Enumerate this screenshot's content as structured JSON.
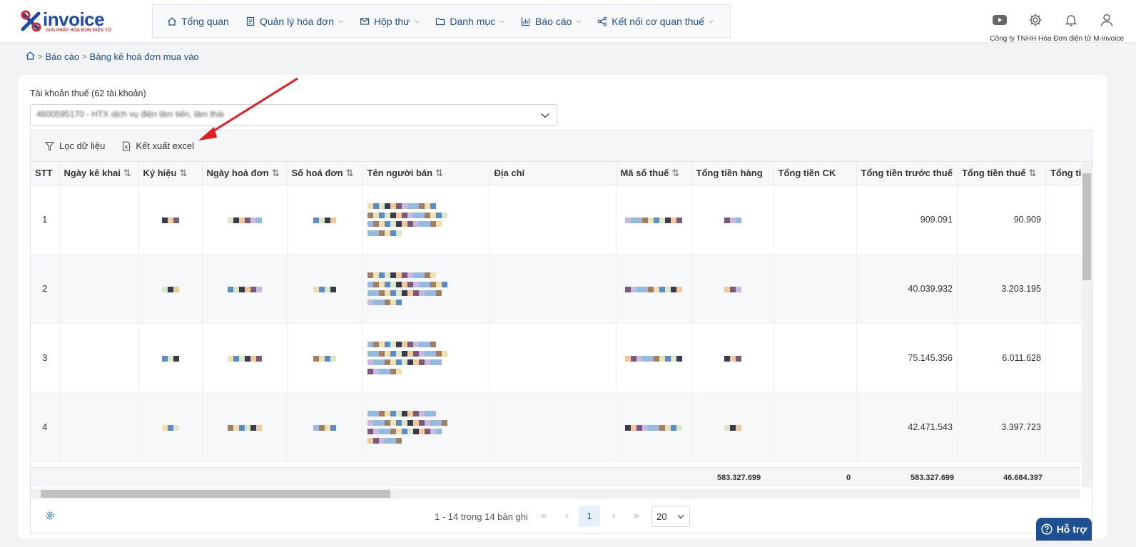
{
  "brand": {
    "name": "invoice",
    "tagline": "GIẢI PHÁP HÓA ĐƠN ĐIỆN TỬ"
  },
  "nav": [
    {
      "label": "Tổng quan",
      "icon": "home-icon",
      "dropdown": false
    },
    {
      "label": "Quản lý hóa đơn",
      "icon": "document-icon",
      "dropdown": true
    },
    {
      "label": "Hộp thư",
      "icon": "mail-icon",
      "dropdown": true
    },
    {
      "label": "Danh mục",
      "icon": "folder-icon",
      "dropdown": true
    },
    {
      "label": "Báo cáo",
      "icon": "bar-chart-icon",
      "dropdown": true
    },
    {
      "label": "Kết nối cơ quan thuế",
      "icon": "share-icon",
      "dropdown": true
    }
  ],
  "header": {
    "company": "Công ty TNHH Hóa Đơn điện tử M-invoice",
    "icons": [
      "youtube-icon",
      "gear-icon",
      "bell-icon",
      "user-icon"
    ]
  },
  "breadcrumb": {
    "home_icon": "home-icon",
    "items": [
      "Báo cáo",
      "Bảng kê hoá đơn mua vào"
    ]
  },
  "account": {
    "label": "Tài khoản thuế (62 tài khoản)",
    "value": "4600595170 - HTX dịch vụ điện lâm tiến, lâm thái"
  },
  "toolbar": {
    "filter_label": "Lọc dữ liệu",
    "export_label": "Kết xuất excel"
  },
  "table": {
    "columns": [
      "STT",
      "Ngày kê khai",
      "Ký hiệu",
      "Ngày hoá đơn",
      "Số hoá đơn",
      "Tên người bán",
      "Địa chỉ",
      "Mã số thuế",
      "Tổng tiền hàng",
      "Tổng tiền CK",
      "Tổng tiền trước thuế",
      "Tổng tiền thuế",
      "Tổng ti"
    ],
    "rows": [
      {
        "stt": "1",
        "truoc_thue": "909.091",
        "thue": "90.909"
      },
      {
        "stt": "2",
        "truoc_thue": "40.039.932",
        "thue": "3.203.195"
      },
      {
        "stt": "3",
        "truoc_thue": "75.145.356",
        "thue": "6.011.628"
      },
      {
        "stt": "4",
        "truoc_thue": "42.471.543",
        "thue": "3.397.723"
      }
    ],
    "totals": {
      "tien_hang": "583.327.699",
      "tien_ck": "0",
      "truoc_thue": "583.327.699",
      "thue": "46.684.397"
    }
  },
  "pager": {
    "info": "1 - 14 trong 14 bản ghi",
    "current": "1",
    "size": "20"
  },
  "help": {
    "label": "Hỗ trợ"
  },
  "colors": {
    "brand": "#1d4f91",
    "arrow": "#e02020",
    "logo_red": "#d92b2b"
  }
}
